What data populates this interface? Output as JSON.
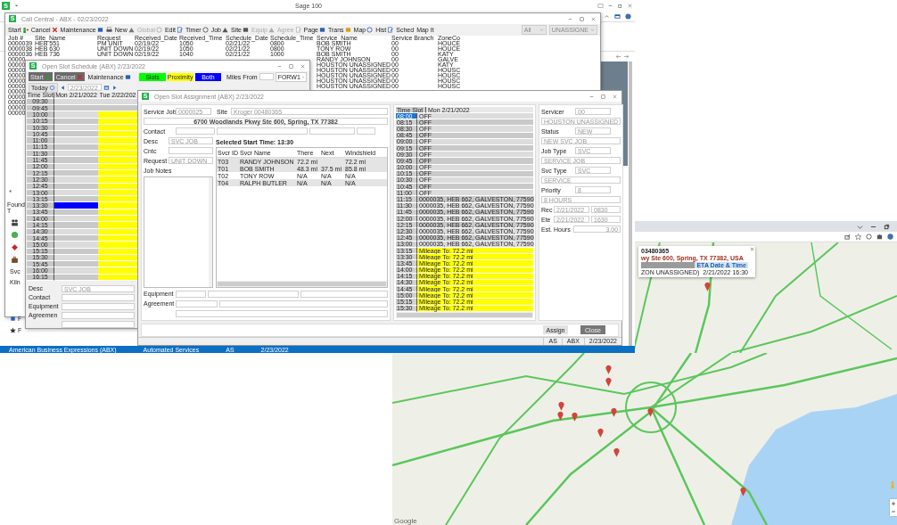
{
  "app": {
    "title": "Sage 100",
    "logo": "S"
  },
  "sage_status": [
    "American Business Expressions (ABX)",
    "Automated Services",
    "AS",
    "2/23/2022"
  ],
  "call_central": {
    "logo": "S",
    "title": "Call Central - ABX - 02/23/2022",
    "toolbar": [
      {
        "kind": "button",
        "label": "Start",
        "disabled": false
      },
      {
        "kind": "button",
        "label": "Cancel",
        "disabled": false
      },
      {
        "kind": "button",
        "label": "Maintenance",
        "disabled": false
      },
      {
        "kind": "icon",
        "disabled": false
      },
      {
        "kind": "button",
        "label": "New",
        "disabled": false
      },
      {
        "kind": "button",
        "label": "Global",
        "disabled": true
      },
      {
        "kind": "button",
        "label": "Edit",
        "disabled": false
      },
      {
        "kind": "button",
        "label": "Timer",
        "disabled": false
      },
      {
        "kind": "button",
        "label": "Job",
        "disabled": false
      },
      {
        "kind": "button",
        "label": "Site",
        "disabled": false
      },
      {
        "kind": "button",
        "label": "Equip",
        "disabled": true
      },
      {
        "kind": "button",
        "label": "Agree",
        "disabled": true
      },
      {
        "kind": "button",
        "label": "Page",
        "disabled": false
      },
      {
        "kind": "button",
        "label": "Trans",
        "disabled": false
      },
      {
        "kind": "button",
        "label": "Map",
        "disabled": false
      },
      {
        "kind": "button",
        "label": "Hist",
        "disabled": false
      },
      {
        "kind": "button",
        "label": "Sched",
        "disabled": false
      },
      {
        "kind": "button",
        "label": "Map It",
        "disabled": false
      }
    ],
    "filters": [
      "All",
      "UNASSIGNE"
    ],
    "columns": [
      "Job #",
      "Site_Name",
      "Request",
      "Received_Date",
      "Received_Time",
      "Schedule_Date",
      "Schedule_Time",
      "Service_Name",
      "Service Branch",
      "ZoneCo"
    ],
    "rows": [
      {
        "job": "0000039",
        "site": "HEB 551",
        "request": "PM UNIT",
        "received_date": "02/19/22",
        "received_time": "1050",
        "schedule_date": "02/21/22",
        "schedule_time": "0800",
        "service_name": "BOB SMITH",
        "branch": "00",
        "zone": "HOUCE"
      },
      {
        "job": "0000038",
        "site": "HEB 630",
        "request": "UNIT DOWN",
        "received_date": "02/19/22",
        "received_time": "1050",
        "schedule_date": "02/21/22",
        "schedule_time": "0800",
        "service_name": "TONY ROW",
        "branch": "00",
        "zone": "HOUCE"
      },
      {
        "job": "0000036",
        "site": "HEB 736",
        "request": "UNIT DOWN",
        "received_date": "02/19/22",
        "received_time": "1040",
        "schedule_date": "02/21/22",
        "schedule_time": "1000",
        "service_name": "BOB SMITH",
        "branch": "00",
        "zone": "KATY"
      },
      {
        "job": "00000",
        "service_name": "RANDY JOHNSON",
        "branch": "00",
        "zone": "GALVE"
      },
      {
        "job": "00000",
        "service_name": "HOUSTON UNASSIGNED",
        "branch": "00",
        "zone": "KATY"
      },
      {
        "job": "00000",
        "service_name": "HOUSTON UNASSIGNED",
        "branch": "00",
        "zone": "HOUSC"
      },
      {
        "job": "00000",
        "service_name": "HOUSTON UNASSIGNED",
        "branch": "00",
        "zone": "HOUSC"
      },
      {
        "job": "00000",
        "service_name": "HOUSTON UNASSIGNED",
        "branch": "00",
        "zone": "HOUSC"
      },
      {
        "job": "00000",
        "service_name": "HOUSTON UNASSIGNED",
        "branch": "00",
        "zone": "HOUSC"
      },
      {
        "job": "00000"
      },
      {
        "job": "00000"
      },
      {
        "job": "00000"
      },
      {
        "job": "00000"
      },
      {
        "job": "00000"
      }
    ],
    "found_label": "Found T",
    "side_texts": [
      "Svc",
      "Kiln"
    ],
    "home_links": [
      "F",
      "F"
    ]
  },
  "schedule": {
    "logo": "S",
    "title": "Open Slot Schedule (ABX) 2/23/2022",
    "buttons": [
      "Start",
      "Cancel",
      "Maintenance"
    ],
    "legend": [
      {
        "label": "Slots",
        "color": "#00ff00"
      },
      {
        "label": "Proximity",
        "color": "#ffff00"
      },
      {
        "label": "Both",
        "color": "#0000ff"
      }
    ],
    "miles_label": "Miles From",
    "miles_select": "FORW1",
    "today": "Today",
    "date": "2/23/2022",
    "columns": [
      "Time Slot",
      "Mon 2/21/2022",
      "Tue 2/22/202"
    ],
    "rows": [
      {
        "time": "09:30",
        "cells": [
          {
            "kind": "none"
          },
          {
            "kind": "none"
          }
        ]
      },
      {
        "time": "09:45",
        "cells": [
          {
            "kind": "none"
          },
          {
            "kind": "none"
          }
        ]
      },
      {
        "time": "10:00",
        "cells": [
          {
            "kind": "none"
          },
          {
            "kind": "proximity"
          }
        ]
      },
      {
        "time": "10:15",
        "cells": [
          {
            "kind": "none"
          },
          {
            "kind": "proximity"
          }
        ]
      },
      {
        "time": "10:30",
        "cells": [
          {
            "kind": "none"
          },
          {
            "kind": "proximity"
          }
        ]
      },
      {
        "time": "10:45",
        "cells": [
          {
            "kind": "none"
          },
          {
            "kind": "proximity"
          }
        ]
      },
      {
        "time": "11:00",
        "cells": [
          {
            "kind": "none"
          },
          {
            "kind": "proximity"
          }
        ]
      },
      {
        "time": "11:15",
        "cells": [
          {
            "kind": "none"
          },
          {
            "kind": "proximity"
          }
        ]
      },
      {
        "time": "11:30",
        "cells": [
          {
            "kind": "none"
          },
          {
            "kind": "proximity"
          }
        ]
      },
      {
        "time": "11:45",
        "cells": [
          {
            "kind": "none"
          },
          {
            "kind": "proximity"
          }
        ]
      },
      {
        "time": "12:00",
        "cells": [
          {
            "kind": "none"
          },
          {
            "kind": "proximity"
          }
        ]
      },
      {
        "time": "12:15",
        "cells": [
          {
            "kind": "none"
          },
          {
            "kind": "proximity"
          }
        ]
      },
      {
        "time": "12:30",
        "cells": [
          {
            "kind": "none"
          },
          {
            "kind": "proximity"
          }
        ]
      },
      {
        "time": "12:45",
        "cells": [
          {
            "kind": "none"
          },
          {
            "kind": "proximity"
          }
        ]
      },
      {
        "time": "13:00",
        "cells": [
          {
            "kind": "none"
          },
          {
            "kind": "proximity"
          }
        ]
      },
      {
        "time": "13:15",
        "cells": [
          {
            "kind": "none"
          },
          {
            "kind": "proximity"
          }
        ]
      },
      {
        "time": "13:30",
        "cells": [
          {
            "kind": "both"
          },
          {
            "kind": "proximity"
          }
        ]
      },
      {
        "time": "13:45",
        "cells": [
          {
            "kind": "none"
          },
          {
            "kind": "proximity"
          }
        ]
      },
      {
        "time": "14:00",
        "cells": [
          {
            "kind": "none"
          },
          {
            "kind": "proximity"
          }
        ]
      },
      {
        "time": "14:15",
        "cells": [
          {
            "kind": "none"
          },
          {
            "kind": "proximity"
          }
        ]
      },
      {
        "time": "14:30",
        "cells": [
          {
            "kind": "none"
          },
          {
            "kind": "proximity"
          }
        ]
      },
      {
        "time": "14:45",
        "cells": [
          {
            "kind": "none"
          },
          {
            "kind": "proximity"
          }
        ]
      },
      {
        "time": "15:00",
        "cells": [
          {
            "kind": "none"
          },
          {
            "kind": "proximity"
          }
        ]
      },
      {
        "time": "15:15",
        "cells": [
          {
            "kind": "none"
          },
          {
            "kind": "proximity"
          }
        ]
      },
      {
        "time": "15:30",
        "cells": [
          {
            "kind": "none"
          },
          {
            "kind": "proximity"
          }
        ]
      },
      {
        "time": "15:45",
        "cells": [
          {
            "kind": "none"
          },
          {
            "kind": "proximity"
          }
        ]
      },
      {
        "time": "16:00",
        "cells": [
          {
            "kind": "none"
          },
          {
            "kind": "proximity"
          }
        ]
      },
      {
        "time": "16:15",
        "cells": [
          {
            "kind": "none"
          },
          {
            "kind": "proximity"
          }
        ]
      }
    ],
    "fields": [
      {
        "label": "Desc",
        "value": "SVC JOB"
      },
      {
        "label": "Contact"
      },
      {
        "label": "Equipment"
      },
      {
        "label": "Agreemen"
      }
    ]
  },
  "assignment": {
    "logo": "S",
    "title": "Open Slot Assignment (ABX) 2/23/2022",
    "service_job": {
      "label": "Service Job",
      "value": "0000025"
    },
    "site": {
      "label": "Site",
      "value": "Kroger 00480365"
    },
    "address": "6700 Woodlands Pkwy Ste 600, Spring, TX 77382",
    "contact_label": "Contact",
    "desc": {
      "label": "Desc",
      "value": "SVC JOB"
    },
    "cntc_label": "Cntc",
    "request": {
      "label": "Request",
      "value": "UNIT DOWN"
    },
    "notes_label": "Job Notes",
    "selected_time": "Selected Start Time: 13:30",
    "svcr_columns": [
      "Svcr ID",
      "Svcr Name",
      "There",
      "Next",
      "Windshield"
    ],
    "svcr_rows": [
      {
        "id": "T03",
        "name": "RANDY JOHNSON",
        "there": "72.2 mi",
        "windshield": "72.2 mi",
        "shaded": true
      },
      {
        "id": "T01",
        "name": "BOB SMITH",
        "there": "48.3 mi",
        "next": "37.5 mi",
        "windshield": "85.8 mi",
        "shaded": true
      },
      {
        "id": "T02",
        "name": "TONY ROW",
        "there": "N/A",
        "next": "N/A",
        "windshield": "N/A",
        "shaded": false
      },
      {
        "id": "T04",
        "name": "RALPH BUTLER",
        "there": "N/A",
        "next": "N/A",
        "windshield": "N/A",
        "shaded": true
      }
    ],
    "equipment_label": "Equipment",
    "agreement_label": "Agreement",
    "slot_columns": [
      "Time Slot",
      "Mon 2/21/2022"
    ],
    "slots": [
      {
        "time": "08:00",
        "text": "OFF",
        "kind": "off",
        "selected": true
      },
      {
        "time": "08:15",
        "text": "OFF",
        "kind": "off",
        "selected": false
      },
      {
        "time": "08:30",
        "text": "OFF",
        "kind": "off",
        "selected": false
      },
      {
        "time": "08:45",
        "text": "OFF",
        "kind": "off",
        "selected": false
      },
      {
        "time": "09:00",
        "text": "OFF",
        "kind": "off",
        "selected": false
      },
      {
        "time": "09:15",
        "text": "OFF",
        "kind": "off",
        "selected": false
      },
      {
        "time": "09:30",
        "text": "OFF",
        "kind": "off",
        "selected": false
      },
      {
        "time": "09:45",
        "text": "OFF",
        "kind": "off",
        "selected": false
      },
      {
        "time": "10:00",
        "text": "OFF",
        "kind": "off",
        "selected": false
      },
      {
        "time": "10:15",
        "text": "OFF",
        "kind": "off",
        "selected": false
      },
      {
        "time": "10:30",
        "text": "OFF",
        "kind": "off",
        "selected": false
      },
      {
        "time": "10:45",
        "text": "OFF",
        "kind": "off",
        "selected": false
      },
      {
        "time": "11:00",
        "text": "OFF",
        "kind": "off",
        "selected": false
      },
      {
        "time": "11:15",
        "text": "0000035, HEB 662, GALVESTON, 77590",
        "kind": "booked",
        "selected": false
      },
      {
        "time": "11:30",
        "text": "0000035, HEB 662, GALVESTON, 77590",
        "kind": "booked",
        "selected": false
      },
      {
        "time": "11:45",
        "text": "0000035, HEB 662, GALVESTON, 77590",
        "kind": "booked",
        "selected": false
      },
      {
        "time": "12:00",
        "text": "0000035, HEB 662, GALVESTON, 77590",
        "kind": "booked",
        "selected": false
      },
      {
        "time": "12:15",
        "text": "0000035, HEB 662, GALVESTON, 77590",
        "kind": "booked",
        "selected": false
      },
      {
        "time": "12:30",
        "text": "0000035, HEB 662, GALVESTON, 77590",
        "kind": "booked",
        "selected": false
      },
      {
        "time": "12:45",
        "text": "0000035, HEB 662, GALVESTON, 77590",
        "kind": "booked",
        "selected": false
      },
      {
        "time": "13:00",
        "text": "0000035, HEB 662, GALVESTON, 77590",
        "kind": "booked",
        "selected": false
      },
      {
        "time": "13:15",
        "text": "Mileage To: 72.2 mi",
        "kind": "proximity",
        "selected": false
      },
      {
        "time": "13:30",
        "text": "Mileage To: 72.2 mi",
        "kind": "proximity",
        "selected": false
      },
      {
        "time": "13:45",
        "text": "Mileage To: 72.2 mi",
        "kind": "proximity",
        "selected": false
      },
      {
        "time": "14:00",
        "text": "Mileage To: 72.2 mi",
        "kind": "proximity",
        "selected": false
      },
      {
        "time": "14:15",
        "text": "Mileage To: 72.2 mi",
        "kind": "proximity",
        "selected": false
      },
      {
        "time": "14:30",
        "text": "Mileage To: 72.2 mi",
        "kind": "proximity",
        "selected": false
      },
      {
        "time": "14:45",
        "text": "Mileage To: 72.2 mi",
        "kind": "proximity",
        "selected": false
      },
      {
        "time": "15:00",
        "text": "Mileage To: 72.2 mi",
        "kind": "proximity",
        "selected": false
      },
      {
        "time": "15:15",
        "text": "Mileage To: 72.2 mi",
        "kind": "proximity",
        "selected": false
      },
      {
        "time": "15:30",
        "text": "Mileage To: 72.2 mi",
        "kind": "proximity",
        "selected": false
      }
    ],
    "details": [
      {
        "kind": "pair",
        "label": "Servicer",
        "value": "00"
      },
      {
        "kind": "wide",
        "value": "HOUSTON UNASSIGNED"
      },
      {
        "kind": "pair",
        "label": "Status",
        "value": "NEW"
      },
      {
        "kind": "wide",
        "value": "NEW SVC JOB"
      },
      {
        "kind": "pair",
        "label": "Job Type",
        "value": "SVC"
      },
      {
        "kind": "wide",
        "value": "SERVICE JOB"
      },
      {
        "kind": "pair",
        "label": "Svc Type",
        "value": "SVC"
      },
      {
        "kind": "wide",
        "value": "SERVICE"
      },
      {
        "kind": "pair",
        "label": "Priority",
        "value": "8"
      },
      {
        "kind": "wide",
        "value": "8 HOURS"
      },
      {
        "kind": "date",
        "label": "Rec",
        "value": "2/21/2022",
        "time": "0830"
      },
      {
        "kind": "date",
        "label": "Ete",
        "value": "2/21/2022",
        "time": "1630"
      },
      {
        "kind": "hours",
        "label": "Est. Hours",
        "value": "3.00"
      }
    ],
    "buttons": [
      "Assign",
      "Close"
    ],
    "status": [
      "AS",
      "ABX",
      "2/23/2022"
    ]
  },
  "map": {
    "popup": {
      "id": "03480365",
      "address": "wy Ste 600, Spring, TX 77382, USA",
      "header": "ETA Date & Time",
      "servicer": "ZON UNASSIGNED)",
      "eta": "2/21/2022 16:30"
    },
    "attribution": "Google"
  }
}
